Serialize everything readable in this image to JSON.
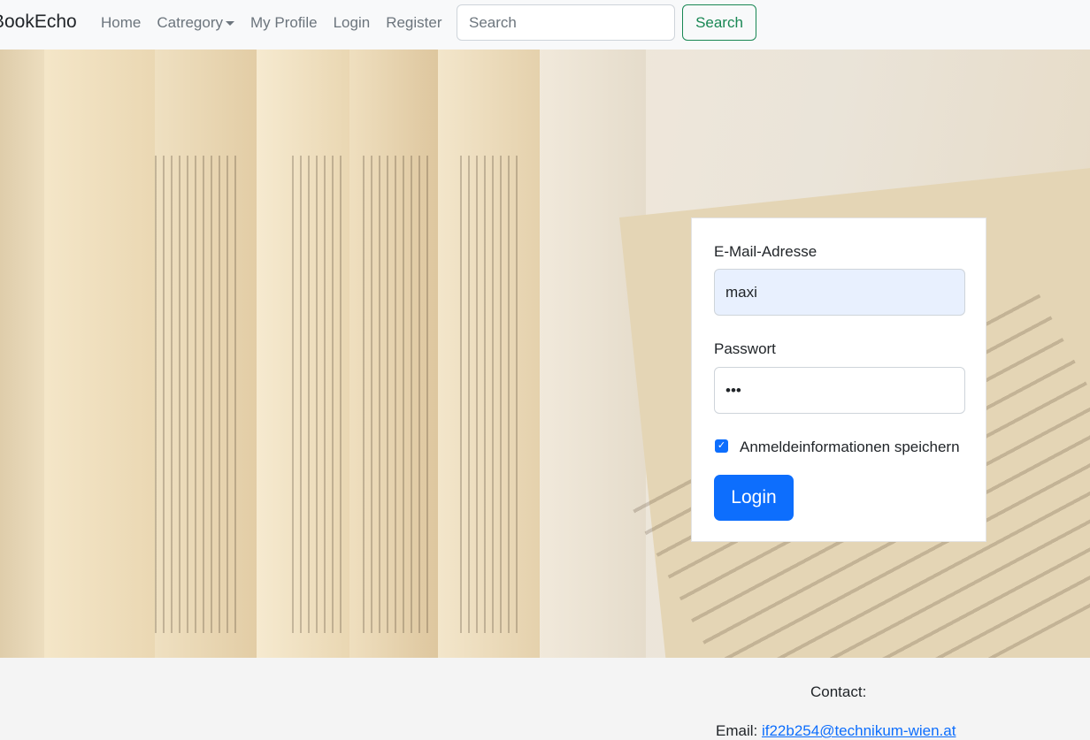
{
  "navbar": {
    "brand": "BookEcho",
    "links": [
      {
        "label": "Home"
      },
      {
        "label": "Catregory"
      },
      {
        "label": "My Profile"
      },
      {
        "label": "Login"
      },
      {
        "label": "Register"
      }
    ],
    "search": {
      "placeholder": "Search",
      "value": ""
    },
    "search_button": "Search"
  },
  "login_form": {
    "email_label": "E-Mail-Adresse",
    "email_value": "maxi",
    "password_label": "Passwort",
    "password_value": "•••",
    "remember_label": "Anmeldeinformationen speichern",
    "remember_checked": true,
    "submit_label": "Login"
  },
  "footer": {
    "contact_title": "Contact:",
    "email_prefix": "Email:",
    "email_address": "if22b254@technikum-wien.at"
  },
  "colors": {
    "primary": "#0d6efd",
    "success": "#198754",
    "navbar_bg": "#f8f9fa",
    "autofill_bg": "#e8f0fe"
  },
  "icons": {
    "dropdown": "caret-down-icon",
    "checkbox": "checkmark-icon"
  }
}
